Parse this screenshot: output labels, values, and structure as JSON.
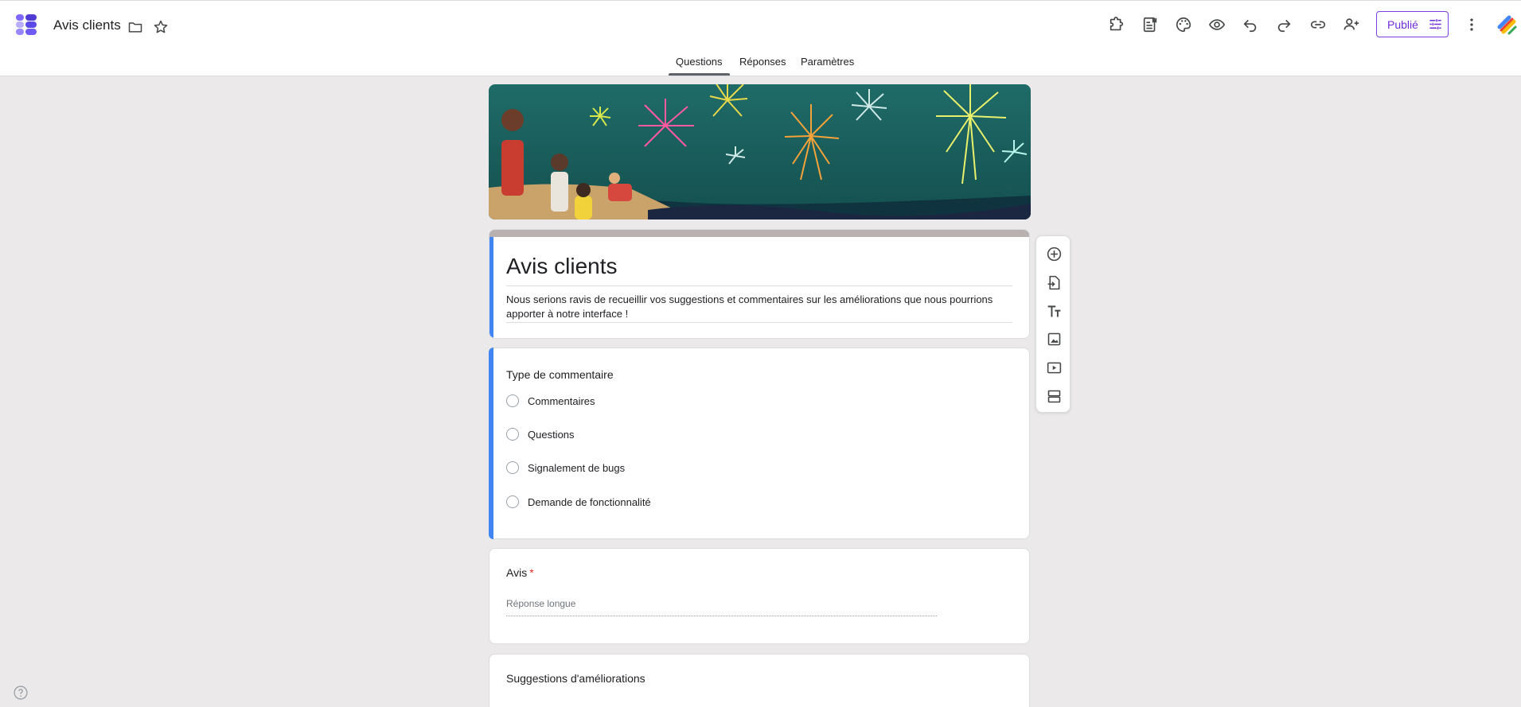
{
  "header": {
    "doc_title": "Avis clients",
    "publish_label": "Publié",
    "icons": [
      "addon-icon",
      "customize-icon",
      "palette-icon",
      "preview-icon",
      "undo-icon",
      "redo-icon",
      "link-icon",
      "add-collaborator-icon",
      "more-vert-icon"
    ]
  },
  "tabs": [
    {
      "label": "Questions",
      "active": true
    },
    {
      "label": "Réponses",
      "active": false
    },
    {
      "label": "Paramètres",
      "active": false
    }
  ],
  "form": {
    "title": "Avis clients",
    "description": "Nous serions ravis de recueillir vos suggestions et commentaires sur les améliorations que nous pourrions apporter à notre interface !"
  },
  "questions": [
    {
      "title": "Type de commentaire",
      "type": "radio",
      "options": [
        "Commentaires",
        "Questions",
        "Signalement de bugs",
        "Demande de fonctionnalité"
      ]
    },
    {
      "title": "Avis",
      "required": "*",
      "type": "paragraph",
      "placeholder": "Réponse longue"
    },
    {
      "title": "Suggestions d'améliorations"
    }
  ],
  "side_toolbar": [
    "add-question-icon",
    "import-questions-icon",
    "add-title-icon",
    "add-image-icon",
    "add-video-icon",
    "add-section-icon"
  ],
  "colors": {
    "accent": "#4285f4",
    "publish": "#6f2ed8",
    "background": "#ebe9ea",
    "header_strip": "#b9b0b0"
  }
}
